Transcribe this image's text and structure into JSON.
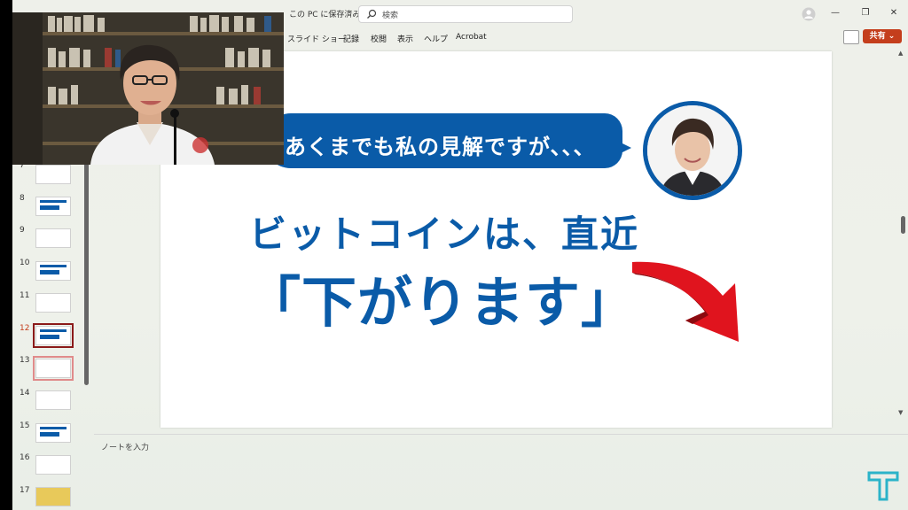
{
  "titlebar": {
    "save_state": "この PC に保存済み",
    "search_placeholder": "検索"
  },
  "ribbon": {
    "tabs": [
      "スライド ショー",
      "記録",
      "校閲",
      "表示",
      "ヘルプ",
      "Acrobat"
    ],
    "share_label": "共有"
  },
  "thumbnails": {
    "numbers": [
      "7",
      "8",
      "9",
      "10",
      "11",
      "12",
      "13",
      "14",
      "15",
      "16",
      "17"
    ],
    "active_number": "12"
  },
  "slide": {
    "bubble_text": "あくまでも私の見解ですが、、、",
    "headline_line1": "ビットコインは、直近",
    "headline_line2": "「下がります」"
  },
  "notes": {
    "placeholder": "ノートを入力"
  },
  "colors": {
    "brand_blue": "#0a5ba8",
    "arrow_red": "#e0141e",
    "share_orange": "#c43e1c",
    "watermark_teal": "#2bb3c9"
  }
}
